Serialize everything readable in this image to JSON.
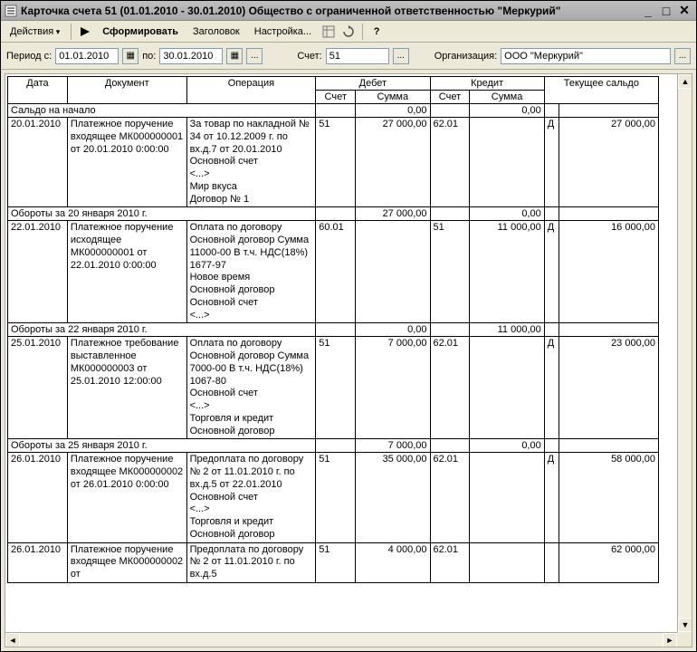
{
  "window": {
    "title": "Карточка счета 51 (01.01.2010 - 30.01.2010) Общество с ограниченной ответственностью \"Меркурий\""
  },
  "toolbar": {
    "actions": "Действия",
    "form": "Сформировать",
    "header": "Заголовок",
    "settings": "Настройка..."
  },
  "params": {
    "period_label": "Период с:",
    "date_from": "01.01.2010",
    "to_label": "по:",
    "date_to": "30.01.2010",
    "account_label": "Счет:",
    "account": "51",
    "org_label": "Организация:",
    "org": "ООО \"Меркурий\""
  },
  "headers": {
    "date": "Дата",
    "doc": "Документ",
    "op": "Операция",
    "debit": "Дебет",
    "credit": "Кредит",
    "balance": "Текущее сальдо",
    "acc": "Счет",
    "sum": "Сумма"
  },
  "opening": {
    "label": "Сальдо на начало",
    "debit": "0,00",
    "credit": "0,00"
  },
  "rows": [
    {
      "date": "20.01.2010",
      "doc": "Платежное поручение входящее МК000000001 от 20.01.2010 0:00:00",
      "op": "За товар по накладной № 34 от 10.12.2009 г. по вх.д.7 от 20.01.2010\nОсновной счет\n<...>\nМир вкуса\nДоговор № 1",
      "d_acc": "51",
      "d_sum": "27 000,00",
      "c_acc": "62.01",
      "c_sum": "",
      "bal": "27 000,00",
      "dc": "Д"
    },
    {
      "subtotal": true,
      "label": "Обороты за 20 января 2010 г.",
      "d_sum": "27 000,00",
      "c_sum": "0,00"
    },
    {
      "date": "22.01.2010",
      "doc": "Платежное поручение исходящее МК000000001 от 22.01.2010 0:00:00",
      "op": "Оплата по договору Основной договор Сумма 11000-00 В т.ч. НДС(18%) 1677-97\nНовое время\nОсновной договор\nОсновной счет\n<...>",
      "d_acc": "60.01",
      "d_sum": "",
      "c_acc": "51",
      "c_sum": "11 000,00",
      "bal": "16 000,00",
      "dc": "Д"
    },
    {
      "subtotal": true,
      "label": "Обороты за 22 января 2010 г.",
      "d_sum": "0,00",
      "c_sum": "11 000,00"
    },
    {
      "date": "25.01.2010",
      "doc": "Платежное требование выставленное МК000000003 от 25.01.2010 12:00:00",
      "op": "Оплата по договору Основной договор Сумма 7000-00 В т.ч. НДС(18%) 1067-80\nОсновной счет\n<...>\nТорговля и кредит\nОсновной договор",
      "d_acc": "51",
      "d_sum": "7 000,00",
      "c_acc": "62.01",
      "c_sum": "",
      "bal": "23 000,00",
      "dc": "Д"
    },
    {
      "subtotal": true,
      "label": "Обороты за 25 января 2010 г.",
      "d_sum": "7 000,00",
      "c_sum": "0,00"
    },
    {
      "date": "26.01.2010",
      "doc": "Платежное поручение входящее МК000000002 от 26.01.2010 0:00:00",
      "op": "Предоплата по договору № 2 от 11.01.2010 г. по вх.д.5 от 22.01.2010\nОсновной счет\n<...>\nТорговля и кредит\nОсновной договор",
      "d_acc": "51",
      "d_sum": "35 000,00",
      "c_acc": "62.01",
      "c_sum": "",
      "bal": "58 000,00",
      "dc": "Д"
    },
    {
      "date": "26.01.2010",
      "doc": "Платежное поручение входящее МК000000002 от",
      "op": "Предоплата по договору № 2 от 11.01.2010 г. по вх.д.5",
      "d_acc": "51",
      "d_sum": "4 000,00",
      "c_acc": "62.01",
      "c_sum": "",
      "bal": "62 000,00",
      "dc": ""
    }
  ]
}
